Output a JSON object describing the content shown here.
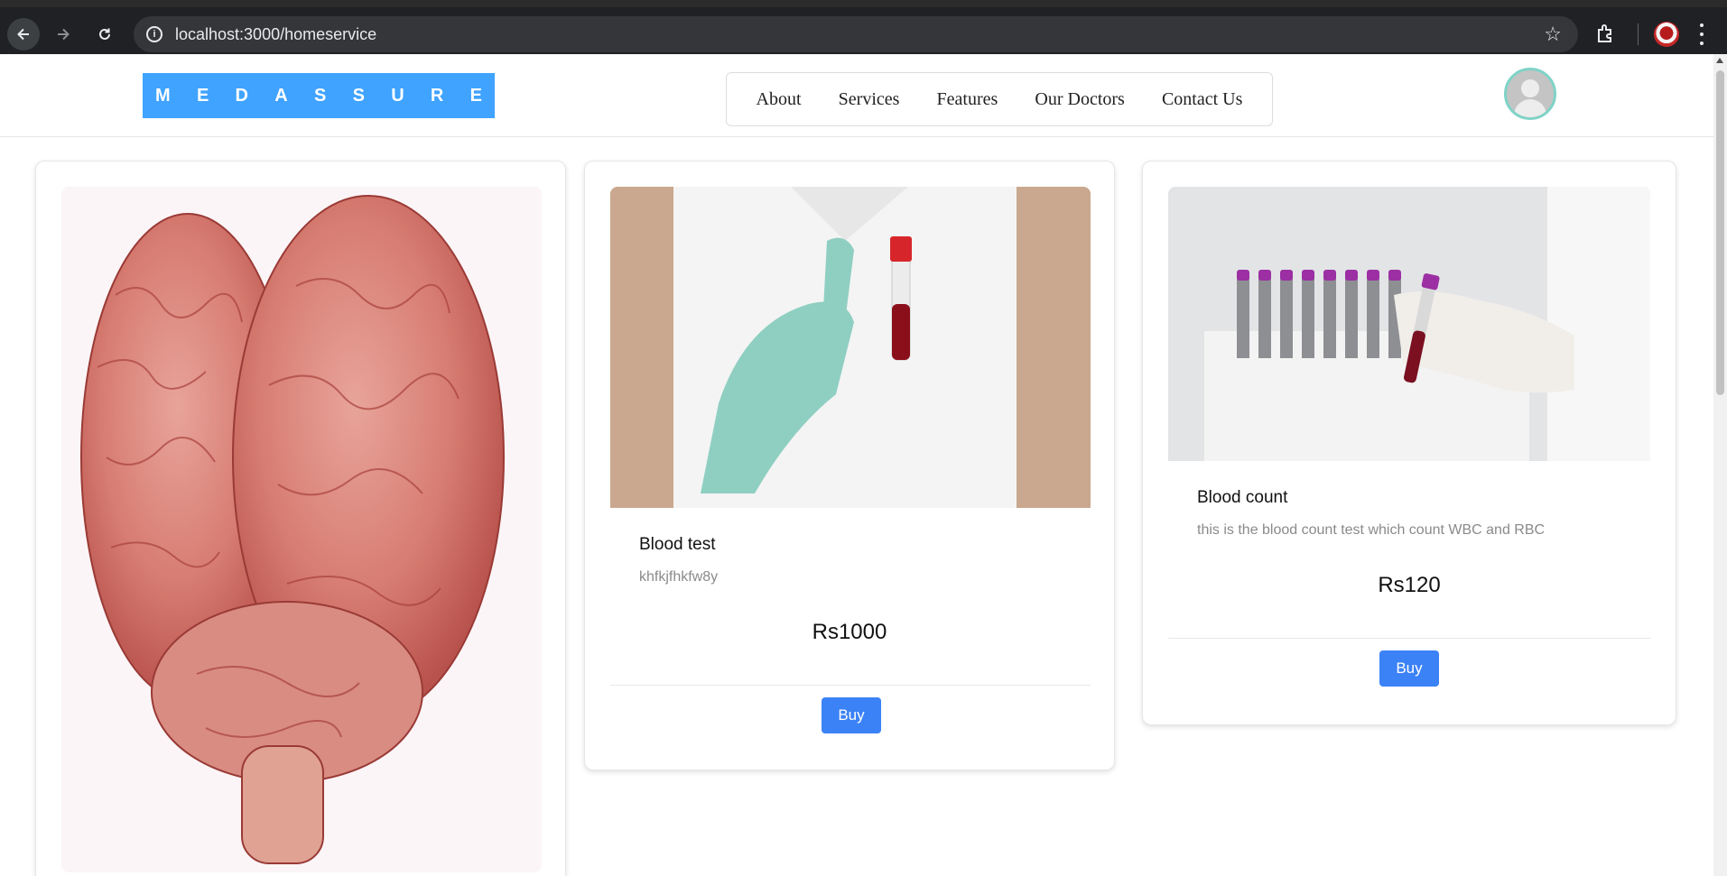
{
  "browser": {
    "url": "localhost:3000/homeservice"
  },
  "header": {
    "logo_letters": [
      "M",
      "E",
      "D",
      "A",
      "S",
      "S",
      "U",
      "R",
      "E"
    ],
    "nav": [
      {
        "label": "About"
      },
      {
        "label": "Services"
      },
      {
        "label": "Features"
      },
      {
        "label": "Our Doctors"
      },
      {
        "label": "Contact Us"
      }
    ]
  },
  "services": [
    {
      "image": "brain-photo"
    },
    {
      "image": "blood-tube-gloved-hand-photo",
      "title": "Blood test",
      "description": "khfkjfhkfw8y",
      "price": "Rs1000",
      "buy_label": "Buy"
    },
    {
      "image": "blood-samples-rack-photo",
      "title": "Blood count",
      "description": "this is the blood count test which count WBC and RBC",
      "price": "Rs120",
      "buy_label": "Buy"
    }
  ],
  "colors": {
    "logo_bg": "#3fa3ff",
    "buy_button": "#3b82f6",
    "avatar_ring": "#7fd3c7",
    "browser_bar": "#202124"
  }
}
